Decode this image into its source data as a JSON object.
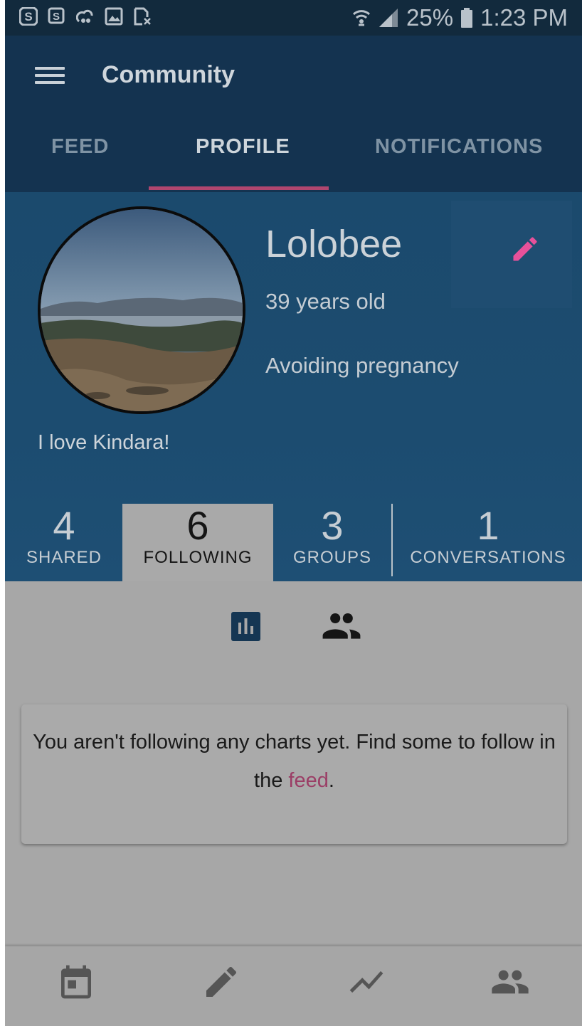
{
  "status_bar": {
    "battery": "25%",
    "time": "1:23 PM"
  },
  "app_bar": {
    "title": "Community",
    "tabs": [
      {
        "label": "FEED"
      },
      {
        "label": "PROFILE"
      },
      {
        "label": "NOTIFICATIONS"
      }
    ],
    "active_tab": "PROFILE"
  },
  "profile": {
    "name": "Lolobee",
    "age": "39 years old",
    "goal": "Avoiding pregnancy",
    "bio": "I love Kindara!",
    "stats": [
      {
        "value": "4",
        "label": "SHARED"
      },
      {
        "value": "6",
        "label": "FOLLOWING"
      },
      {
        "value": "3",
        "label": "GROUPS"
      },
      {
        "value": "1",
        "label": "CONVERSATIONS"
      }
    ],
    "active_stat": "FOLLOWING"
  },
  "following": {
    "message_before": "You aren't following any charts yet. Find some to follow in the ",
    "message_link": "feed",
    "message_after": "."
  },
  "bottom_nav": {
    "items": [
      "calendar-icon",
      "pencil-icon",
      "trend-chart-icon",
      "people-icon"
    ]
  },
  "colors": {
    "app_bar": "#143350",
    "accent": "#e7519a",
    "tab_indicator": "#b0466f",
    "content_background": "#a7a7a7"
  }
}
